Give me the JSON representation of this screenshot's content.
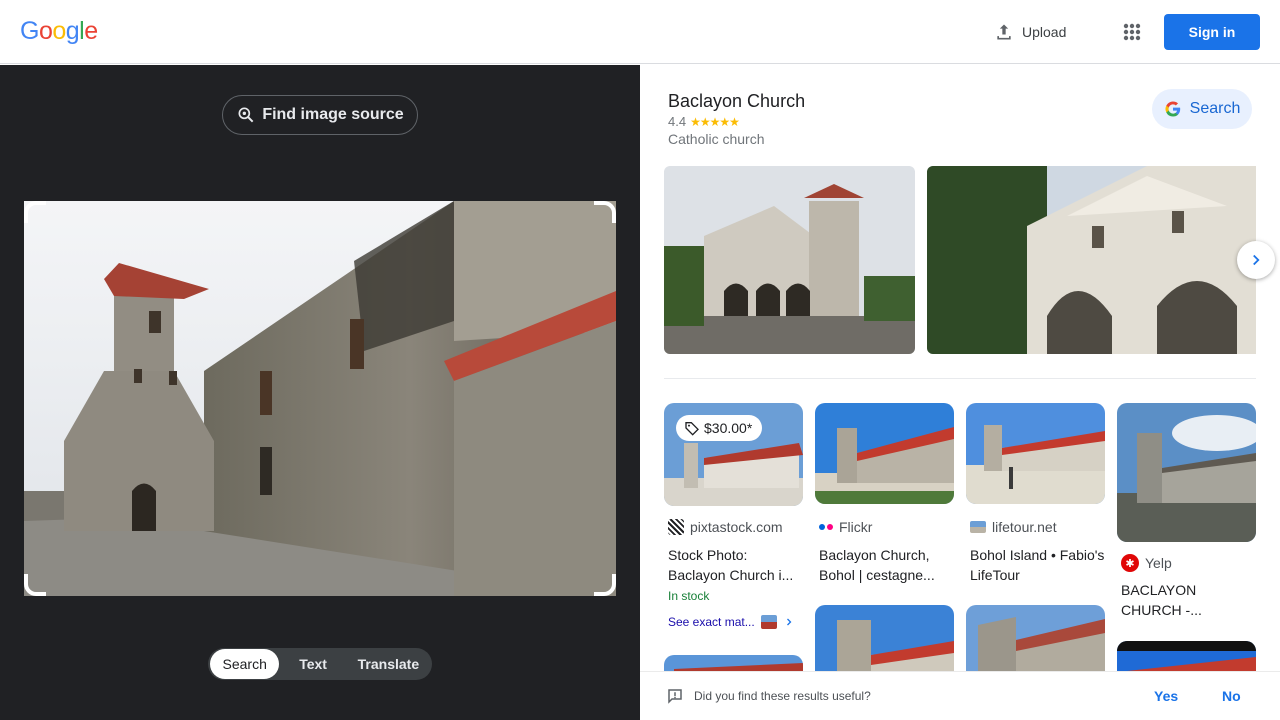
{
  "header": {
    "logo": [
      "G",
      "o",
      "o",
      "g",
      "l",
      "e"
    ],
    "logo_colors": [
      "#4285f4",
      "#ea4335",
      "#fbbc05",
      "#4285f4",
      "#34a853",
      "#ea4335"
    ],
    "upload_label": "Upload",
    "signin_label": "Sign in"
  },
  "left_panel": {
    "find_source_label": "Find image source",
    "modes": [
      "Search",
      "Text",
      "Translate"
    ],
    "active_mode": "Search"
  },
  "knowledge_panel": {
    "title": "Baclayon Church",
    "rating": "4.4",
    "stars": "★★★★★",
    "subtitle": "Catholic church",
    "search_label": "Search"
  },
  "results": [
    {
      "price": "$30.00*",
      "source": "pixtastock.com",
      "title": "Stock Photo: Baclayon Church i...",
      "stock": "In stock",
      "exact": "See exact mat..."
    },
    {
      "source": "Flickr",
      "title": "Baclayon Church, Bohol | cestagne..."
    },
    {
      "source": "lifetour.net",
      "title": "Bohol Island • Fabio's LifeTour"
    },
    {
      "source": "Yelp",
      "title": "BACLAYON CHURCH -..."
    }
  ],
  "feedback": {
    "question": "Did you find these results useful?",
    "yes": "Yes",
    "no": "No"
  },
  "colors": {
    "accent": "#1a73e8",
    "dark_panel": "#202124",
    "star": "#fbbc04"
  }
}
